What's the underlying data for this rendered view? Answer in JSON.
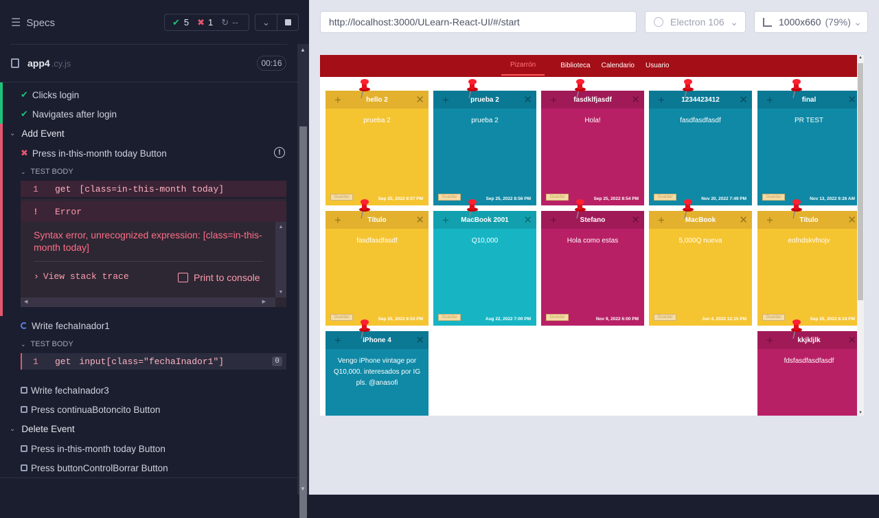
{
  "specs_title": "Specs",
  "stats": {
    "passed": "5",
    "failed": "1",
    "pending": "--"
  },
  "spec": {
    "name": "app4",
    "ext": ".cy.js",
    "duration": "00:16"
  },
  "tests": {
    "clicks_login": "Clicks login",
    "navigates": "Navigates after login",
    "add_event": "Add Event",
    "press_today": "Press in-this-month today Button",
    "test_body": "TEST BODY",
    "cmd1_num": "1",
    "cmd1_name": "get",
    "cmd1_arg": "[class=in-this-month today]",
    "err_mark": "!",
    "err_label": "Error",
    "err_message": "Syntax error, unrecognized expression: [class=in-this-month today]",
    "stack_trace": "View stack trace",
    "print_console": "Print to console",
    "write_f1": "Write fechaInador1",
    "test_body2": "TEST BODY",
    "cmd2_num": "1",
    "cmd2_name": "get",
    "cmd2_arg": "input[class=\"fechaInador1\"]",
    "cmd2_count": "0",
    "write_f3": "Write fechaInador3",
    "press_cont": "Press continuaBotoncito Button",
    "delete_event": "Delete Event",
    "press_today2": "Press in-this-month today Button",
    "press_borrar": "Press buttonControlBorrar Button"
  },
  "url": "http://localhost:3000/ULearn-React-UI/#/start",
  "browser": "Electron 106",
  "viewport": "1000x660",
  "zoom": "(79%)",
  "nav": [
    "Pizarrón",
    "Biblioteca",
    "Calendario",
    "Usuario"
  ],
  "notes": [
    {
      "title": "hello 2",
      "body": "prueba 2",
      "date": "Sep 25, 2022 8:57 PM",
      "btn": "Guardar",
      "color": "#f5c431",
      "head": "#e3b12e"
    },
    {
      "title": "prueba 2",
      "body": "prueba 2",
      "date": "Sep 25, 2022 8:56 PM",
      "btn": "Guardar",
      "color": "#0f89a6",
      "head": "#0b7894"
    },
    {
      "title": "fasdklfjasdf",
      "body": "Hola!",
      "date": "Sep 25, 2022 8:54 PM",
      "btn": "Guardar",
      "color": "#b82066",
      "head": "#a01a58"
    },
    {
      "title": "1234423412",
      "body": "fasdfasdfasdf",
      "date": "Nov 20, 2022 7:49 PM",
      "btn": "Guardar",
      "color": "#0f89a6",
      "head": "#0b7894"
    },
    {
      "title": "final",
      "body": "PR TEST",
      "date": "Nov 13, 2022 9:26 AM",
      "btn": "Guardar",
      "color": "#0f89a6",
      "head": "#0b7894"
    },
    {
      "title": "Título",
      "body": "fasdfasdfasdf",
      "date": "Sep 25, 2022 8:53 PM",
      "btn": "Guardar",
      "color": "#f5c431",
      "head": "#e3b12e"
    },
    {
      "title": "MacBook 2001",
      "body": "Q10,000",
      "date": "Aug 22, 2022 7:00 PM",
      "btn": "Guardar",
      "color": "#17b5c4",
      "head": "#12a0ae"
    },
    {
      "title": "Stefano",
      "body": "Hola como estas",
      "date": "Nov 9, 2022 6:00 PM",
      "btn": "Guardar",
      "color": "#b82066",
      "head": "#a01a58"
    },
    {
      "title": "MacBook",
      "body": "5,000Q nueva",
      "date": "Jun 4, 2022 12:15 PM",
      "btn": "Guardar",
      "color": "#f5c431",
      "head": "#e3b12e"
    },
    {
      "title": "Título",
      "body": "eofndskvfnojv",
      "date": "Sep 25, 2022 8:24 PM",
      "btn": "Guardar",
      "color": "#f5c431",
      "head": "#e3b12e"
    },
    {
      "title": "iPhone 4",
      "body": "Vengo iPhone vintage por Q10,000. interesados por IG pls. @anasofi",
      "date": "",
      "btn": "",
      "color": "#0f89a6",
      "head": "#0b7894"
    },
    {
      "title": "kkjkljlk",
      "body": "fdsfasdfasdfasdf",
      "date": "",
      "btn": "",
      "color": "#b82066",
      "head": "#a01a58"
    }
  ]
}
